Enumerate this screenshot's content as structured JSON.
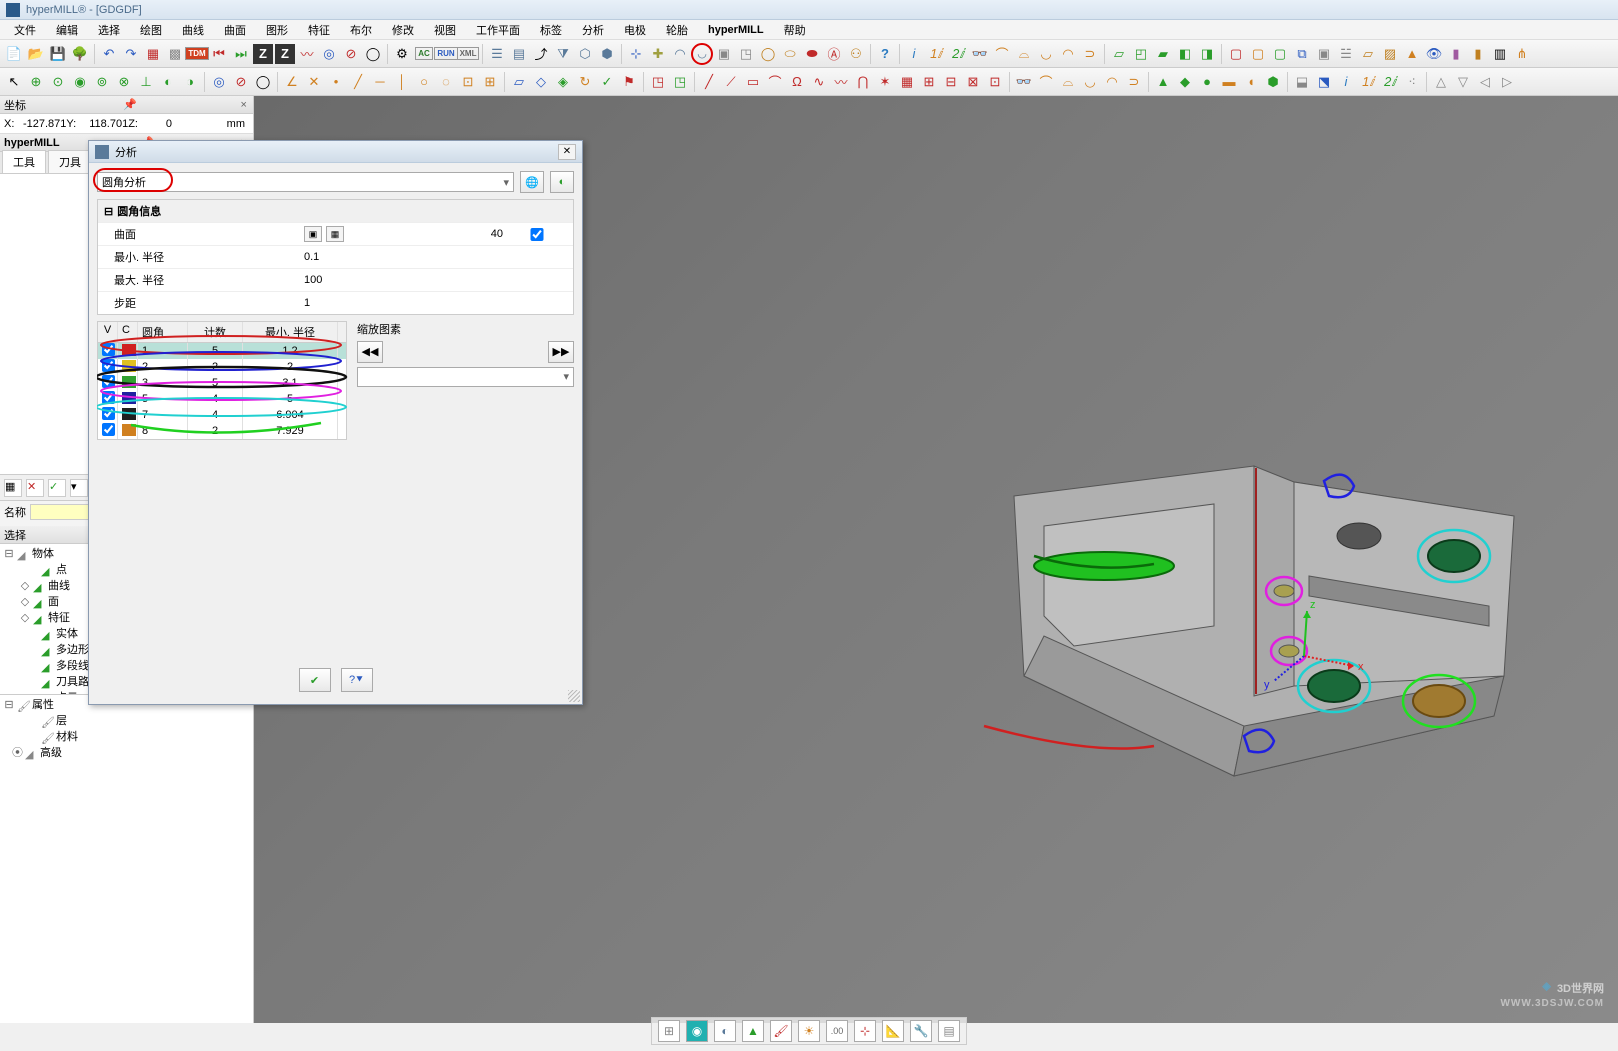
{
  "window": {
    "title": "hyperMILL® - [GDGDF]"
  },
  "menu": [
    "文件",
    "编辑",
    "选择",
    "绘图",
    "曲线",
    "曲面",
    "图形",
    "特征",
    "布尔",
    "修改",
    "视图",
    "工作平面",
    "标签",
    "分析",
    "电极",
    "轮胎",
    "hyperMILL",
    "帮助"
  ],
  "coord_panel": {
    "title": "坐标",
    "x_label": "X:",
    "x_val": "-127.871",
    "y_label": "Y:",
    "y_val": "118.701",
    "z_label": "Z:",
    "z_val": "0",
    "unit": "mm"
  },
  "left": {
    "hypermill_tab": "hyperMILL",
    "tabs": [
      "工具",
      "刀具"
    ],
    "name_label": "名称",
    "select_header": "选择",
    "tree1": [
      {
        "exp": "⊟",
        "label": "物体",
        "ind": 0
      },
      {
        "exp": "",
        "label": "点",
        "ind": 24,
        "color": "#2a9d2a"
      },
      {
        "exp": "◇",
        "label": "曲线",
        "ind": 16,
        "color": "#2a9d2a"
      },
      {
        "exp": "◇",
        "label": "面",
        "ind": 16,
        "color": "#2a9d2a"
      },
      {
        "exp": "◇",
        "label": "特征",
        "ind": 16,
        "color": "#2a9d2a"
      },
      {
        "exp": "",
        "label": "实体",
        "ind": 24,
        "color": "#2a9d2a"
      },
      {
        "exp": "",
        "label": "多边形网格",
        "ind": 24,
        "color": "#2a9d2a"
      },
      {
        "exp": "",
        "label": "多段线",
        "ind": 24,
        "color": "#2a9d2a"
      },
      {
        "exp": "",
        "label": "刀具路径",
        "ind": 24,
        "color": "#2a9d2a"
      },
      {
        "exp": "",
        "label": "点云",
        "ind": 24,
        "color": "#2a9d2a"
      }
    ],
    "tree2": [
      {
        "exp": "⊟",
        "label": "属性",
        "ind": 0,
        "icon": "🖌"
      },
      {
        "exp": "",
        "label": "层",
        "ind": 24,
        "icon": "🖌"
      },
      {
        "exp": "",
        "label": "材料",
        "ind": 24,
        "icon": "🖌"
      },
      {
        "exp": "⦿",
        "label": "高级",
        "ind": 8
      }
    ]
  },
  "dialog": {
    "title": "分析",
    "dropdown": "圆角分析",
    "group_title": "圆角信息",
    "rows": [
      {
        "label": "曲面",
        "type": "btns",
        "val": "40"
      },
      {
        "label": "最小. 半径",
        "val": "0.1"
      },
      {
        "label": "最大. 半径",
        "val": "100"
      },
      {
        "label": "步距",
        "val": "1"
      }
    ],
    "table_headers": {
      "v": "V",
      "c": "C",
      "r": "圆角",
      "n": "计数",
      "m": "最小. 半径"
    },
    "table_rows": [
      {
        "v": true,
        "color": "#d02020",
        "r": "1",
        "n": "5",
        "m": "1.2",
        "sel": true
      },
      {
        "v": true,
        "color": "#e0c020",
        "r": "2",
        "n": "2",
        "m": "2"
      },
      {
        "v": true,
        "color": "#30a030",
        "r": "3",
        "n": "5",
        "m": "3.1"
      },
      {
        "v": true,
        "color": "#2020a0",
        "r": "5",
        "n": "4",
        "m": "5"
      },
      {
        "v": true,
        "color": "#202020",
        "r": "7",
        "n": "4",
        "m": "6.904"
      },
      {
        "v": true,
        "color": "#d08020",
        "r": "8",
        "n": "2",
        "m": "7.929"
      }
    ],
    "zoom_label": "缩放图素",
    "zoom_prev": "◀◀",
    "zoom_next": "▶▶"
  },
  "watermark": {
    "main": "3D世界网",
    "sub": "WWW.3DSJW.COM"
  },
  "axes": {
    "x": "x",
    "y": "y",
    "z": "z"
  }
}
